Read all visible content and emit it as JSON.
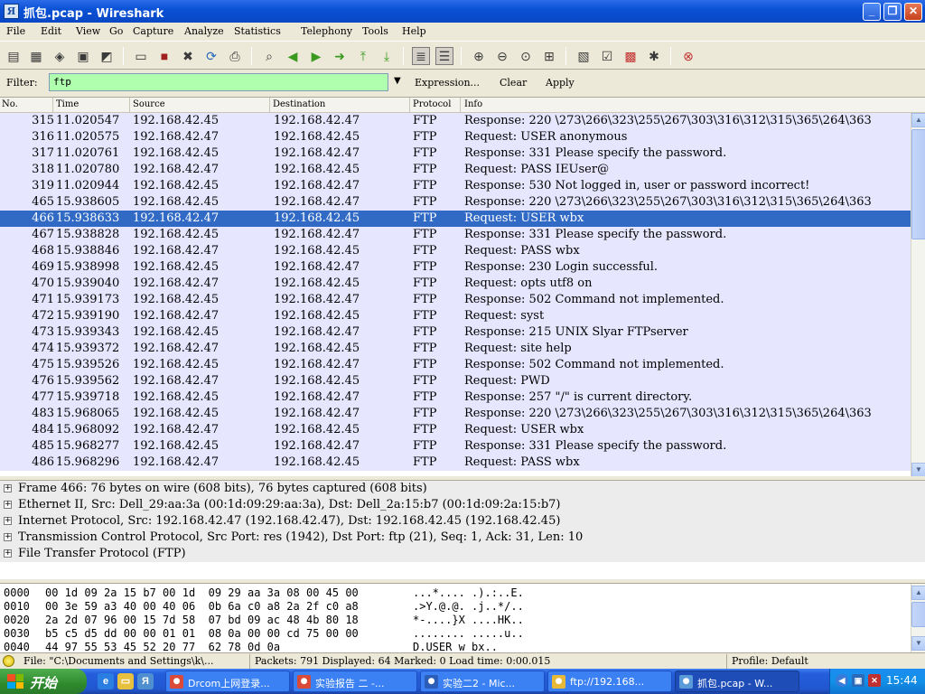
{
  "window": {
    "title": "抓包.pcap - Wireshark",
    "buttons": {
      "minimize": "_",
      "maximize": "❐",
      "close": "✕"
    }
  },
  "menu": [
    "File",
    "Edit",
    "View",
    "Go",
    "Capture",
    "Analyze",
    "Statistics",
    "Telephony",
    "Tools",
    "Help"
  ],
  "toolbar": {
    "icons": [
      "interface-list-icon",
      "capture-options-icon",
      "start-capture-icon",
      "stop-capture-icon",
      "restart-capture-icon",
      "open-file-icon",
      "save-file-icon",
      "close-file-icon",
      "reload-icon",
      "print-icon",
      "find-packet-icon",
      "go-back-icon",
      "go-forward-icon",
      "go-to-packet-icon",
      "go-first-icon",
      "go-last-icon",
      "colorize-icon",
      "auto-scroll-icon",
      "zoom-in-icon",
      "zoom-out-icon",
      "zoom-normal-icon",
      "resize-columns-icon",
      "capture-filters-icon",
      "display-filters-icon",
      "coloring-rules-icon",
      "preferences-icon",
      "help-icon"
    ]
  },
  "filter": {
    "label": "Filter:",
    "value": "ftp",
    "expression": "Expression...",
    "clear": "Clear",
    "apply": "Apply"
  },
  "packet_list": {
    "columns": [
      "No.",
      "Time",
      "Source",
      "Destination",
      "Protocol",
      "Info"
    ],
    "selected_no": "466",
    "rows": [
      {
        "no": "315",
        "time": "11.020547",
        "src": "192.168.42.45",
        "dst": "192.168.42.47",
        "proto": "FTP",
        "info": "Response: 220 \\273\\266\\323\\255\\267\\303\\316\\312\\315\\365\\264\\363"
      },
      {
        "no": "316",
        "time": "11.020575",
        "src": "192.168.42.47",
        "dst": "192.168.42.45",
        "proto": "FTP",
        "info": "Request: USER anonymous"
      },
      {
        "no": "317",
        "time": "11.020761",
        "src": "192.168.42.45",
        "dst": "192.168.42.47",
        "proto": "FTP",
        "info": "Response: 331 Please specify the password."
      },
      {
        "no": "318",
        "time": "11.020780",
        "src": "192.168.42.47",
        "dst": "192.168.42.45",
        "proto": "FTP",
        "info": "Request: PASS IEUser@"
      },
      {
        "no": "319",
        "time": "11.020944",
        "src": "192.168.42.45",
        "dst": "192.168.42.47",
        "proto": "FTP",
        "info": "Response: 530 Not logged in, user or password incorrect!"
      },
      {
        "no": "465",
        "time": "15.938605",
        "src": "192.168.42.45",
        "dst": "192.168.42.47",
        "proto": "FTP",
        "info": "Response: 220 \\273\\266\\323\\255\\267\\303\\316\\312\\315\\365\\264\\363"
      },
      {
        "no": "466",
        "time": "15.938633",
        "src": "192.168.42.47",
        "dst": "192.168.42.45",
        "proto": "FTP",
        "info": "Request: USER wbx"
      },
      {
        "no": "467",
        "time": "15.938828",
        "src": "192.168.42.45",
        "dst": "192.168.42.47",
        "proto": "FTP",
        "info": "Response: 331 Please specify the password."
      },
      {
        "no": "468",
        "time": "15.938846",
        "src": "192.168.42.47",
        "dst": "192.168.42.45",
        "proto": "FTP",
        "info": "Request: PASS wbx"
      },
      {
        "no": "469",
        "time": "15.938998",
        "src": "192.168.42.45",
        "dst": "192.168.42.47",
        "proto": "FTP",
        "info": "Response: 230 Login successful."
      },
      {
        "no": "470",
        "time": "15.939040",
        "src": "192.168.42.47",
        "dst": "192.168.42.45",
        "proto": "FTP",
        "info": "Request: opts utf8 on"
      },
      {
        "no": "471",
        "time": "15.939173",
        "src": "192.168.42.45",
        "dst": "192.168.42.47",
        "proto": "FTP",
        "info": "Response: 502 Command not implemented."
      },
      {
        "no": "472",
        "time": "15.939190",
        "src": "192.168.42.47",
        "dst": "192.168.42.45",
        "proto": "FTP",
        "info": "Request: syst"
      },
      {
        "no": "473",
        "time": "15.939343",
        "src": "192.168.42.45",
        "dst": "192.168.42.47",
        "proto": "FTP",
        "info": "Response: 215 UNIX Slyar FTPserver"
      },
      {
        "no": "474",
        "time": "15.939372",
        "src": "192.168.42.47",
        "dst": "192.168.42.45",
        "proto": "FTP",
        "info": "Request: site help"
      },
      {
        "no": "475",
        "time": "15.939526",
        "src": "192.168.42.45",
        "dst": "192.168.42.47",
        "proto": "FTP",
        "info": "Response: 502 Command not implemented."
      },
      {
        "no": "476",
        "time": "15.939562",
        "src": "192.168.42.47",
        "dst": "192.168.42.45",
        "proto": "FTP",
        "info": "Request: PWD"
      },
      {
        "no": "477",
        "time": "15.939718",
        "src": "192.168.42.45",
        "dst": "192.168.42.47",
        "proto": "FTP",
        "info": "Response: 257 \"/\" is current directory."
      },
      {
        "no": "483",
        "time": "15.968065",
        "src": "192.168.42.45",
        "dst": "192.168.42.47",
        "proto": "FTP",
        "info": "Response: 220 \\273\\266\\323\\255\\267\\303\\316\\312\\315\\365\\264\\363"
      },
      {
        "no": "484",
        "time": "15.968092",
        "src": "192.168.42.47",
        "dst": "192.168.42.45",
        "proto": "FTP",
        "info": "Request: USER wbx"
      },
      {
        "no": "485",
        "time": "15.968277",
        "src": "192.168.42.45",
        "dst": "192.168.42.47",
        "proto": "FTP",
        "info": "Response: 331 Please specify the password."
      },
      {
        "no": "486",
        "time": "15.968296",
        "src": "192.168.42.47",
        "dst": "192.168.42.45",
        "proto": "FTP",
        "info": "Request: PASS wbx"
      }
    ]
  },
  "details": [
    "Frame 466: 76 bytes on wire (608 bits), 76 bytes captured (608 bits)",
    "Ethernet II, Src: Dell_29:aa:3a (00:1d:09:29:aa:3a), Dst: Dell_2a:15:b7 (00:1d:09:2a:15:b7)",
    "Internet Protocol, Src: 192.168.42.47 (192.168.42.47), Dst: 192.168.42.45 (192.168.42.45)",
    "Transmission Control Protocol, Src Port: res (1942), Dst Port: ftp (21), Seq: 1, Ack: 31, Len: 10",
    "File Transfer Protocol (FTP)"
  ],
  "hex": [
    {
      "offset": "0000",
      "bytes": "00 1d 09 2a 15 b7 00 1d  09 29 aa 3a 08 00 45 00",
      "ascii": "...*.... .).:..E."
    },
    {
      "offset": "0010",
      "bytes": "00 3e 59 a3 40 00 40 06  0b 6a c0 a8 2a 2f c0 a8",
      "ascii": ".>Y.@.@. .j..*/.."
    },
    {
      "offset": "0020",
      "bytes": "2a 2d 07 96 00 15 7d 58  07 bd 09 ac 48 4b 80 18",
      "ascii": "*-....}X ....HK.."
    },
    {
      "offset": "0030",
      "bytes": "b5 c5 d5 dd 00 00 01 01  08 0a 00 00 cd 75 00 00",
      "ascii": "........ .....u.."
    },
    {
      "offset": "0040",
      "bytes": "44 97 55 53 45 52 20 77  62 78 0d 0a",
      "ascii": "D.USER w bx.."
    }
  ],
  "status": {
    "file": "File: \"C:\\Documents and Settings\\k\\...",
    "packets": "Packets: 791 Displayed: 64 Marked: 0 Load time: 0:00.015",
    "profile": "Profile: Default"
  },
  "taskbar": {
    "start": "开始",
    "tasks": [
      {
        "label": "Drcom上网登录...",
        "icon": "chrome-icon",
        "color": "#d94a38"
      },
      {
        "label": "实验报告 二 -...",
        "icon": "chrome-icon",
        "color": "#d94a38"
      },
      {
        "label": "实验二2 - Mic...",
        "icon": "word-icon",
        "color": "#2b5eb8"
      },
      {
        "label": "ftp://192.168...",
        "icon": "folder-icon",
        "color": "#e8b838"
      },
      {
        "label": "抓包.pcap - W...",
        "icon": "wireshark-icon",
        "color": "#5a9ad8"
      }
    ],
    "clock": "15:44"
  }
}
